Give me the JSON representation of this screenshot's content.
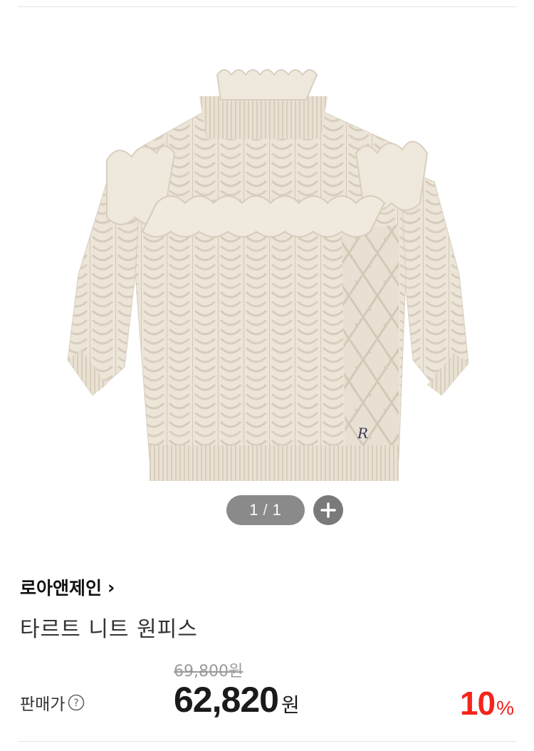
{
  "product": {
    "image_alt": "타르트 니트 원피스",
    "pager": {
      "current": "1",
      "separator": "/",
      "total": "1"
    },
    "brand": "로아앤제인",
    "brand_chevron": "›",
    "title": "타르트 니트 원피스",
    "original_price": "69,800원",
    "price_label": "판매가",
    "sale_price": "62,820",
    "currency_unit": "원",
    "discount_value": "10",
    "discount_unit": "%"
  },
  "icons": {
    "zoom": "plus-icon",
    "help": "question-circle-icon",
    "brand_arrow": "chevron-right-icon"
  },
  "colors": {
    "discount": "#f5241b",
    "pager_bg": "#8a8a8a",
    "zoom_bg": "#7a7a7a",
    "original_price": "#9a9a9a",
    "sweater": "#ece4d7"
  }
}
